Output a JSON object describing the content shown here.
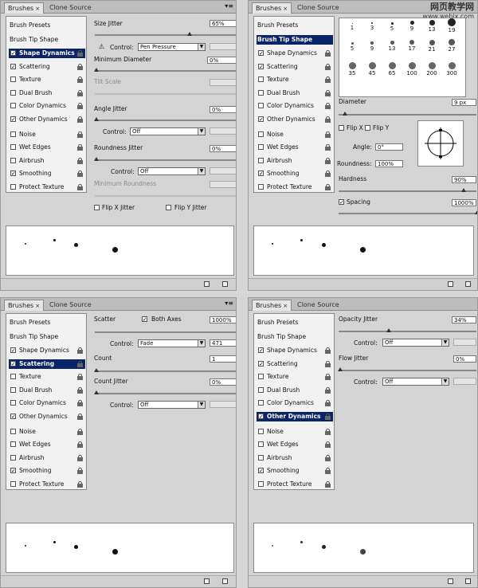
{
  "panels": [
    {
      "tabs": {
        "brushes": "Brushes",
        "clone": "Clone Source",
        "close": "×",
        "menu": "▾≡"
      },
      "left": {
        "presets": "Brush Presets",
        "tip_shape": "Brush Tip Shape",
        "items": [
          {
            "label": "Shape Dynamics",
            "checked": true,
            "selected": true
          },
          {
            "label": "Scattering",
            "checked": true,
            "selected": false
          },
          {
            "label": "Texture",
            "checked": false,
            "selected": false
          },
          {
            "label": "Dual Brush",
            "checked": false,
            "selected": false
          },
          {
            "label": "Color Dynamics",
            "checked": false,
            "selected": false
          },
          {
            "label": "Other Dynamics",
            "checked": true,
            "selected": false
          },
          {
            "label": "Noise",
            "checked": false,
            "selected": false
          },
          {
            "label": "Wet Edges",
            "checked": false,
            "selected": false
          },
          {
            "label": "Airbrush",
            "checked": false,
            "selected": false
          },
          {
            "label": "Smoothing",
            "checked": true,
            "selected": false
          },
          {
            "label": "Protect Texture",
            "checked": false,
            "selected": false
          }
        ]
      },
      "right": {
        "size_jitter": "Size Jitter",
        "size_jitter_val": "65%",
        "control": "Control:",
        "control_val": "Pen Pressure",
        "min_diameter": "Minimum Diameter",
        "min_diameter_val": "0%",
        "tilt_scale": "Tilt Scale",
        "angle_jitter": "Angle Jitter",
        "angle_jitter_val": "0%",
        "control2": "Control:",
        "control2_val": "Off",
        "roundness_jitter": "Roundness Jitter",
        "roundness_jitter_val": "0%",
        "control3": "Control:",
        "control3_val": "Off",
        "min_roundness": "Minimum Roundness",
        "flip_x": "Flip X Jitter",
        "flip_y": "Flip Y Jitter",
        "warning_icon": "warning-icon"
      }
    },
    {
      "tabs": {
        "brushes": "Brushes",
        "clone": "Clone Source",
        "close": "×"
      },
      "watermark": {
        "title": "网页教学网",
        "url": "www.webjx.com"
      },
      "left": {
        "presets": "Brush Presets",
        "tip_shape": "Brush Tip Shape",
        "items": [
          {
            "label": "Shape Dynamics",
            "checked": true
          },
          {
            "label": "Scattering",
            "checked": true
          },
          {
            "label": "Texture",
            "checked": false
          },
          {
            "label": "Dual Brush",
            "checked": false
          },
          {
            "label": "Color Dynamics",
            "checked": false
          },
          {
            "label": "Other Dynamics",
            "checked": true
          },
          {
            "label": "Noise",
            "checked": false
          },
          {
            "label": "Wet Edges",
            "checked": false
          },
          {
            "label": "Airbrush",
            "checked": false
          },
          {
            "label": "Smoothing",
            "checked": true
          },
          {
            "label": "Protect Texture",
            "checked": false
          }
        ]
      },
      "right": {
        "swatches": [
          "1",
          "3",
          "5",
          "9",
          "13",
          "19",
          "5",
          "9",
          "13",
          "17",
          "21",
          "27",
          "35",
          "45",
          "65",
          "100",
          "200",
          "300"
        ],
        "diameter": "Diameter",
        "diameter_val": "9 px",
        "flip_x": "Flip X",
        "flip_y": "Flip Y",
        "angle": "Angle:",
        "angle_val": "0°",
        "roundness": "Roundness:",
        "roundness_val": "100%",
        "hardness": "Hardness",
        "hardness_val": "90%",
        "spacing": "Spacing",
        "spacing_val": "1000%"
      }
    },
    {
      "tabs": {
        "brushes": "Brushes",
        "clone": "Clone Source",
        "close": "×",
        "menu": "▾≡"
      },
      "left": {
        "presets": "Brush Presets",
        "tip_shape": "Brush Tip Shape",
        "items": [
          {
            "label": "Shape Dynamics",
            "checked": true
          },
          {
            "label": "Scattering",
            "checked": true
          },
          {
            "label": "Texture",
            "checked": false
          },
          {
            "label": "Dual Brush",
            "checked": false
          },
          {
            "label": "Color Dynamics",
            "checked": false
          },
          {
            "label": "Other Dynamics",
            "checked": true
          },
          {
            "label": "Noise",
            "checked": false
          },
          {
            "label": "Wet Edges",
            "checked": false
          },
          {
            "label": "Airbrush",
            "checked": false
          },
          {
            "label": "Smoothing",
            "checked": true
          },
          {
            "label": "Protect Texture",
            "checked": false
          }
        ]
      },
      "right": {
        "scatter": "Scatter",
        "both_axes": "Both Axes",
        "scatter_val": "1000%",
        "control": "Control:",
        "control_val": "Fade",
        "fade_val": "471",
        "count": "Count",
        "count_val": "1",
        "count_jitter": "Count Jitter",
        "count_jitter_val": "0%",
        "control2": "Control:",
        "control2_val": "Off"
      }
    },
    {
      "tabs": {
        "brushes": "Brushes",
        "clone": "Clone Source",
        "close": "×"
      },
      "left": {
        "presets": "Brush Presets",
        "tip_shape": "Brush Tip Shape",
        "items": [
          {
            "label": "Shape Dynamics",
            "checked": true
          },
          {
            "label": "Scattering",
            "checked": true
          },
          {
            "label": "Texture",
            "checked": false
          },
          {
            "label": "Dual Brush",
            "checked": false
          },
          {
            "label": "Color Dynamics",
            "checked": false
          },
          {
            "label": "Other Dynamics",
            "checked": true
          },
          {
            "label": "Noise",
            "checked": false
          },
          {
            "label": "Wet Edges",
            "checked": false
          },
          {
            "label": "Airbrush",
            "checked": false
          },
          {
            "label": "Smoothing",
            "checked": true
          },
          {
            "label": "Protect Texture",
            "checked": false
          }
        ]
      },
      "right": {
        "opacity_jitter": "Opacity Jitter",
        "opacity_jitter_val": "34%",
        "control": "Control:",
        "control_val": "Off",
        "flow_jitter": "Flow Jitter",
        "flow_jitter_val": "0%",
        "control2": "Control:",
        "control2_val": "Off"
      }
    }
  ]
}
